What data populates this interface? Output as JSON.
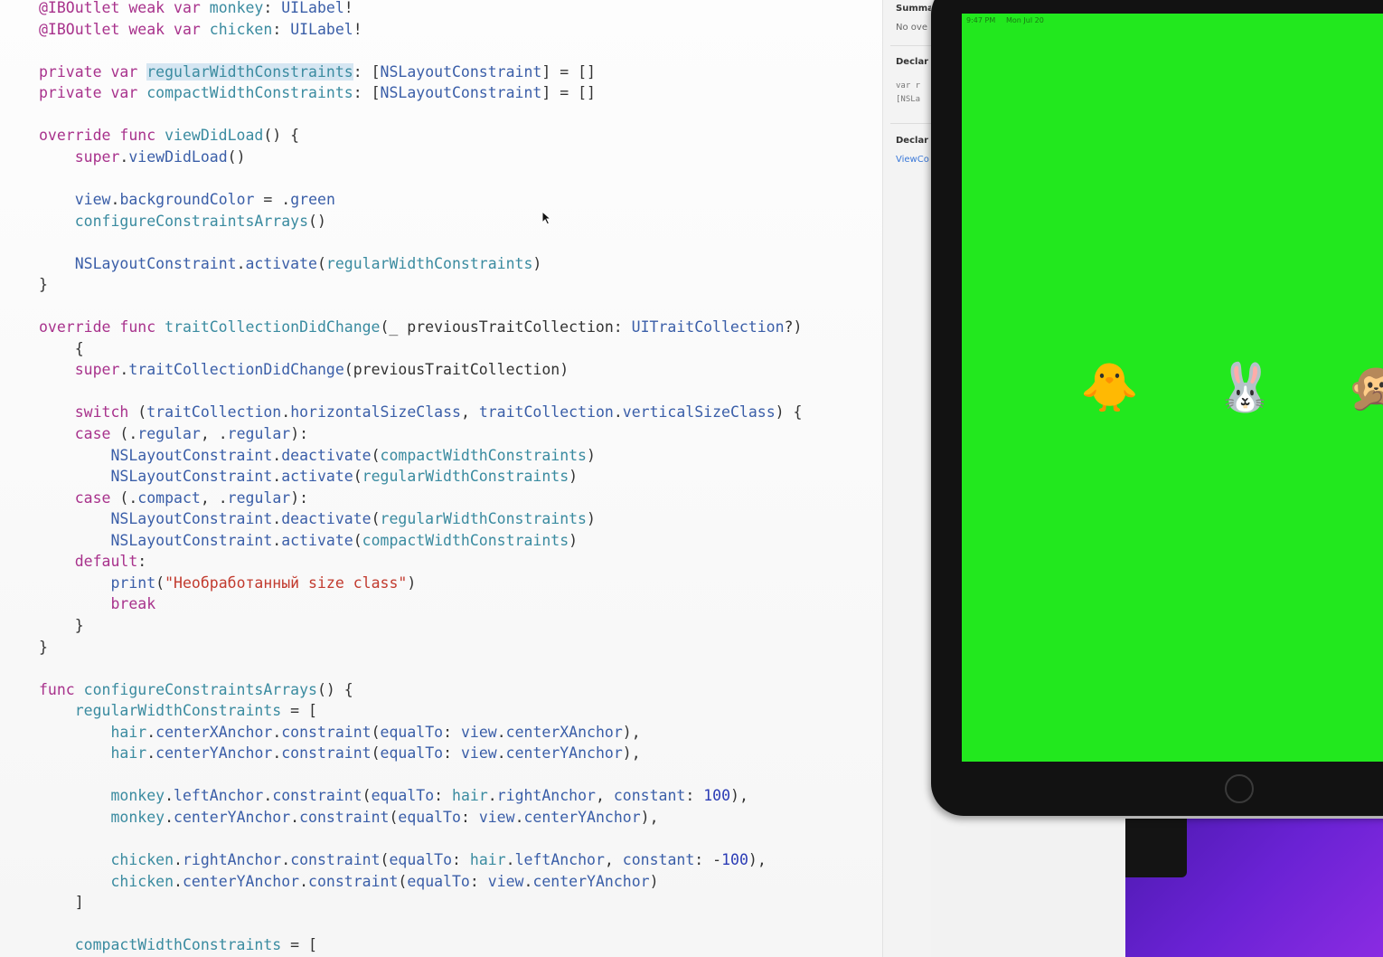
{
  "editor": {
    "lines": [
      [
        [
          "kw",
          "@IBOutlet "
        ],
        [
          "kw",
          "weak "
        ],
        [
          "kw",
          "var "
        ],
        [
          "id",
          "monkey"
        ],
        [
          "pl",
          ": "
        ],
        [
          "tp",
          "UILabel"
        ],
        [
          "pl",
          "!"
        ]
      ],
      [
        [
          "kw",
          "@IBOutlet "
        ],
        [
          "kw",
          "weak "
        ],
        [
          "kw",
          "var "
        ],
        [
          "id",
          "chicken"
        ],
        [
          "pl",
          ": "
        ],
        [
          "tp",
          "UILabel"
        ],
        [
          "pl",
          "!"
        ]
      ],
      [],
      [
        [
          "kw",
          "private "
        ],
        [
          "kw",
          "var "
        ],
        [
          "id hl",
          "regularWidthConstraints"
        ],
        [
          "pl",
          ": ["
        ],
        [
          "tp",
          "NSLayoutConstraint"
        ],
        [
          "pl",
          "] = []"
        ]
      ],
      [
        [
          "kw",
          "private "
        ],
        [
          "kw",
          "var "
        ],
        [
          "id",
          "compactWidthConstraints"
        ],
        [
          "pl",
          ": ["
        ],
        [
          "tp",
          "NSLayoutConstraint"
        ],
        [
          "pl",
          "] = []"
        ]
      ],
      [],
      [
        [
          "kw",
          "override "
        ],
        [
          "kw",
          "func "
        ],
        [
          "id",
          "viewDidLoad"
        ],
        [
          "pl",
          "() {"
        ]
      ],
      [
        [
          "pl",
          "    "
        ],
        [
          "kw",
          "super"
        ],
        [
          "pl",
          "."
        ],
        [
          "tp",
          "viewDidLoad"
        ],
        [
          "pl",
          "()"
        ]
      ],
      [],
      [
        [
          "pl",
          "    "
        ],
        [
          "tp",
          "view"
        ],
        [
          "pl",
          "."
        ],
        [
          "tp",
          "backgroundColor"
        ],
        [
          "pl",
          " = ."
        ],
        [
          "tp",
          "green"
        ]
      ],
      [
        [
          "pl",
          "    "
        ],
        [
          "id",
          "configureConstraintsArrays"
        ],
        [
          "pl",
          "()"
        ]
      ],
      [],
      [
        [
          "pl",
          "    "
        ],
        [
          "tp",
          "NSLayoutConstraint"
        ],
        [
          "pl",
          "."
        ],
        [
          "tp",
          "activate"
        ],
        [
          "pl",
          "("
        ],
        [
          "id",
          "regularWidthConstraints"
        ],
        [
          "pl",
          ")"
        ]
      ],
      [
        [
          "pl",
          "}"
        ]
      ],
      [],
      [
        [
          "kw",
          "override "
        ],
        [
          "kw",
          "func "
        ],
        [
          "id",
          "traitCollectionDidChange"
        ],
        [
          "pl",
          "(_ previousTraitCollection: "
        ],
        [
          "tp",
          "UITraitCollection"
        ],
        [
          "pl",
          "?)"
        ]
      ],
      [
        [
          "pl",
          "    {"
        ]
      ],
      [
        [
          "pl",
          "    "
        ],
        [
          "kw",
          "super"
        ],
        [
          "pl",
          "."
        ],
        [
          "tp",
          "traitCollectionDidChange"
        ],
        [
          "pl",
          "(previousTraitCollection)"
        ]
      ],
      [],
      [
        [
          "pl",
          "    "
        ],
        [
          "kw",
          "switch "
        ],
        [
          "pl",
          "("
        ],
        [
          "tp",
          "traitCollection"
        ],
        [
          "pl",
          "."
        ],
        [
          "tp",
          "horizontalSizeClass"
        ],
        [
          "pl",
          ", "
        ],
        [
          "tp",
          "traitCollection"
        ],
        [
          "pl",
          "."
        ],
        [
          "tp",
          "verticalSizeClass"
        ],
        [
          "pl",
          ") {"
        ]
      ],
      [
        [
          "pl",
          "    "
        ],
        [
          "kw",
          "case "
        ],
        [
          "pl",
          "(."
        ],
        [
          "tp",
          "regular"
        ],
        [
          "pl",
          ", ."
        ],
        [
          "tp",
          "regular"
        ],
        [
          "pl",
          "):"
        ]
      ],
      [
        [
          "pl",
          "        "
        ],
        [
          "tp",
          "NSLayoutConstraint"
        ],
        [
          "pl",
          "."
        ],
        [
          "tp",
          "deactivate"
        ],
        [
          "pl",
          "("
        ],
        [
          "id",
          "compactWidthConstraints"
        ],
        [
          "pl",
          ")"
        ]
      ],
      [
        [
          "pl",
          "        "
        ],
        [
          "tp",
          "NSLayoutConstraint"
        ],
        [
          "pl",
          "."
        ],
        [
          "tp",
          "activate"
        ],
        [
          "pl",
          "("
        ],
        [
          "id",
          "regularWidthConstraints"
        ],
        [
          "pl",
          ")"
        ]
      ],
      [
        [
          "pl",
          "    "
        ],
        [
          "kw",
          "case "
        ],
        [
          "pl",
          "(."
        ],
        [
          "tp",
          "compact"
        ],
        [
          "pl",
          ", ."
        ],
        [
          "tp",
          "regular"
        ],
        [
          "pl",
          "):"
        ]
      ],
      [
        [
          "pl",
          "        "
        ],
        [
          "tp",
          "NSLayoutConstraint"
        ],
        [
          "pl",
          "."
        ],
        [
          "tp",
          "deactivate"
        ],
        [
          "pl",
          "("
        ],
        [
          "id",
          "regularWidthConstraints"
        ],
        [
          "pl",
          ")"
        ]
      ],
      [
        [
          "pl",
          "        "
        ],
        [
          "tp",
          "NSLayoutConstraint"
        ],
        [
          "pl",
          "."
        ],
        [
          "tp",
          "activate"
        ],
        [
          "pl",
          "("
        ],
        [
          "id",
          "compactWidthConstraints"
        ],
        [
          "pl",
          ")"
        ]
      ],
      [
        [
          "pl",
          "    "
        ],
        [
          "kw",
          "default"
        ],
        [
          "pl",
          ":"
        ]
      ],
      [
        [
          "pl",
          "        "
        ],
        [
          "tp",
          "print"
        ],
        [
          "pl",
          "("
        ],
        [
          "st",
          "\"Необработанный size class\""
        ],
        [
          "pl",
          ")"
        ]
      ],
      [
        [
          "pl",
          "        "
        ],
        [
          "kw",
          "break"
        ]
      ],
      [
        [
          "pl",
          "    }"
        ]
      ],
      [
        [
          "pl",
          "}"
        ]
      ],
      [],
      [
        [
          "kw",
          "func "
        ],
        [
          "id",
          "configureConstraintsArrays"
        ],
        [
          "pl",
          "() {"
        ]
      ],
      [
        [
          "pl",
          "    "
        ],
        [
          "id",
          "regularWidthConstraints"
        ],
        [
          "pl",
          " = ["
        ]
      ],
      [
        [
          "pl",
          "        "
        ],
        [
          "id",
          "hair"
        ],
        [
          "pl",
          "."
        ],
        [
          "tp",
          "centerXAnchor"
        ],
        [
          "pl",
          "."
        ],
        [
          "tp",
          "constraint"
        ],
        [
          "pl",
          "("
        ],
        [
          "tp",
          "equalTo"
        ],
        [
          "pl",
          ": "
        ],
        [
          "tp",
          "view"
        ],
        [
          "pl",
          "."
        ],
        [
          "tp",
          "centerXAnchor"
        ],
        [
          "pl",
          "),"
        ]
      ],
      [
        [
          "pl",
          "        "
        ],
        [
          "id",
          "hair"
        ],
        [
          "pl",
          "."
        ],
        [
          "tp",
          "centerYAnchor"
        ],
        [
          "pl",
          "."
        ],
        [
          "tp",
          "constraint"
        ],
        [
          "pl",
          "("
        ],
        [
          "tp",
          "equalTo"
        ],
        [
          "pl",
          ": "
        ],
        [
          "tp",
          "view"
        ],
        [
          "pl",
          "."
        ],
        [
          "tp",
          "centerYAnchor"
        ],
        [
          "pl",
          "),"
        ]
      ],
      [],
      [
        [
          "pl",
          "        "
        ],
        [
          "id",
          "monkey"
        ],
        [
          "pl",
          "."
        ],
        [
          "tp",
          "leftAnchor"
        ],
        [
          "pl",
          "."
        ],
        [
          "tp",
          "constraint"
        ],
        [
          "pl",
          "("
        ],
        [
          "tp",
          "equalTo"
        ],
        [
          "pl",
          ": "
        ],
        [
          "id",
          "hair"
        ],
        [
          "pl",
          "."
        ],
        [
          "tp",
          "rightAnchor"
        ],
        [
          "pl",
          ", "
        ],
        [
          "tp",
          "constant"
        ],
        [
          "pl",
          ": "
        ],
        [
          "nm",
          "100"
        ],
        [
          "pl",
          "),"
        ]
      ],
      [
        [
          "pl",
          "        "
        ],
        [
          "id",
          "monkey"
        ],
        [
          "pl",
          "."
        ],
        [
          "tp",
          "centerYAnchor"
        ],
        [
          "pl",
          "."
        ],
        [
          "tp",
          "constraint"
        ],
        [
          "pl",
          "("
        ],
        [
          "tp",
          "equalTo"
        ],
        [
          "pl",
          ": "
        ],
        [
          "tp",
          "view"
        ],
        [
          "pl",
          "."
        ],
        [
          "tp",
          "centerYAnchor"
        ],
        [
          "pl",
          "),"
        ]
      ],
      [],
      [
        [
          "pl",
          "        "
        ],
        [
          "id",
          "chicken"
        ],
        [
          "pl",
          "."
        ],
        [
          "tp",
          "rightAnchor"
        ],
        [
          "pl",
          "."
        ],
        [
          "tp",
          "constraint"
        ],
        [
          "pl",
          "("
        ],
        [
          "tp",
          "equalTo"
        ],
        [
          "pl",
          ": "
        ],
        [
          "id",
          "hair"
        ],
        [
          "pl",
          "."
        ],
        [
          "tp",
          "leftAnchor"
        ],
        [
          "pl",
          ", "
        ],
        [
          "tp",
          "constant"
        ],
        [
          "pl",
          ": -"
        ],
        [
          "nm",
          "100"
        ],
        [
          "pl",
          "),"
        ]
      ],
      [
        [
          "pl",
          "        "
        ],
        [
          "id",
          "chicken"
        ],
        [
          "pl",
          "."
        ],
        [
          "tp",
          "centerYAnchor"
        ],
        [
          "pl",
          "."
        ],
        [
          "tp",
          "constraint"
        ],
        [
          "pl",
          "("
        ],
        [
          "tp",
          "equalTo"
        ],
        [
          "pl",
          ": "
        ],
        [
          "tp",
          "view"
        ],
        [
          "pl",
          "."
        ],
        [
          "tp",
          "centerYAnchor"
        ],
        [
          "pl",
          ")"
        ]
      ],
      [
        [
          "pl",
          "    ]"
        ]
      ],
      [],
      [
        [
          "pl",
          "    "
        ],
        [
          "id",
          "compactWidthConstraints"
        ],
        [
          "pl",
          " = ["
        ]
      ]
    ]
  },
  "inspector": {
    "summary_heading": "Summa",
    "summary_text": "No ove",
    "declaration_heading": "Declar",
    "declaration_code_1": "var r",
    "declaration_code_2": "[NSLa",
    "declared_in_heading": "Declar",
    "declared_in_link": "ViewCo"
  },
  "simulator": {
    "status_time": "9:47 PM",
    "status_date": "Mon Jul 20",
    "background_color": "#22e81e",
    "labels": [
      {
        "name": "chicken-label",
        "emoji": "🐥"
      },
      {
        "name": "hair-label",
        "emoji": "🐰"
      },
      {
        "name": "monkey-label",
        "emoji": "🙊"
      }
    ]
  }
}
